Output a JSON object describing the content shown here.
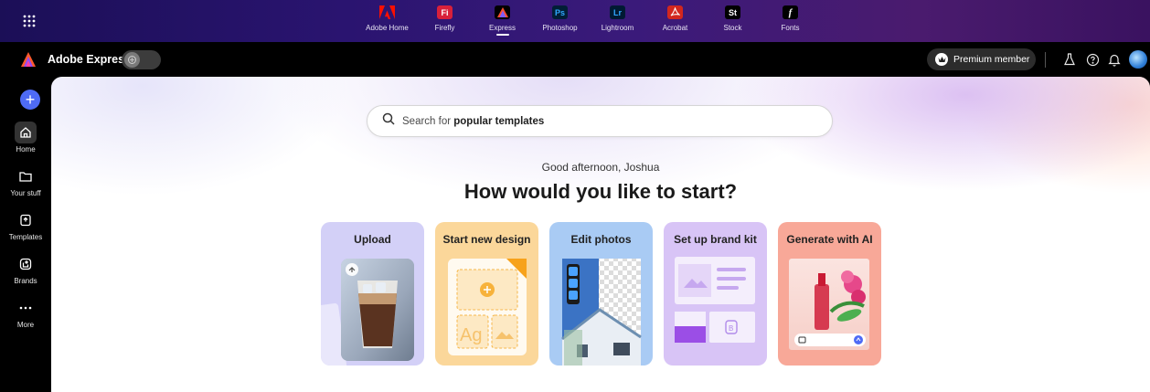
{
  "appbar": {
    "apps": [
      {
        "label": "Adobe Home",
        "icon": "adobe-icon",
        "color": "#e2231a",
        "glyph": ""
      },
      {
        "label": "Firefly",
        "icon": "firefly-icon",
        "color": "#d9203a",
        "glyph": "Fi"
      },
      {
        "label": "Express",
        "icon": "express-icon",
        "color": "#000000",
        "glyph": ""
      },
      {
        "label": "Photoshop",
        "icon": "photoshop-icon",
        "color": "#001e36",
        "glyph": "Ps"
      },
      {
        "label": "Lightroom",
        "icon": "lightroom-icon",
        "color": "#001a33",
        "glyph": "Lr"
      },
      {
        "label": "Acrobat",
        "icon": "acrobat-icon",
        "color": "#d2271e",
        "glyph": ""
      },
      {
        "label": "Stock",
        "icon": "stock-icon",
        "color": "#000000",
        "glyph": "St"
      },
      {
        "label": "Fonts",
        "icon": "fonts-icon",
        "color": "#000000",
        "glyph": "f"
      }
    ],
    "active_app": "Express"
  },
  "header": {
    "brand_name": "Adobe Express",
    "premium_label": "Premium member"
  },
  "rail": {
    "items": [
      {
        "label": "Home",
        "icon": "home-icon"
      },
      {
        "label": "Your stuff",
        "icon": "folder-icon"
      },
      {
        "label": "Templates",
        "icon": "templates-icon"
      },
      {
        "label": "Brands",
        "icon": "brands-icon"
      },
      {
        "label": "More",
        "icon": "more-icon"
      }
    ]
  },
  "main": {
    "search_prefix": "Search for ",
    "search_bold": "popular templates",
    "greeting": "Good afternoon, Joshua",
    "headline": "How would you like to start?",
    "cards": [
      {
        "label": "Upload"
      },
      {
        "label": "Start new design"
      },
      {
        "label": "Edit photos"
      },
      {
        "label": "Set up brand kit"
      },
      {
        "label": "Generate with AI"
      }
    ]
  },
  "colors": {
    "accent": "#4e6bf5",
    "upload_card": "#d3d0f7",
    "design_card": "#fbd79a",
    "photos_card": "#a9cbf4",
    "brand_card": "#d8c4f6",
    "ai_card": "#f8a898"
  }
}
